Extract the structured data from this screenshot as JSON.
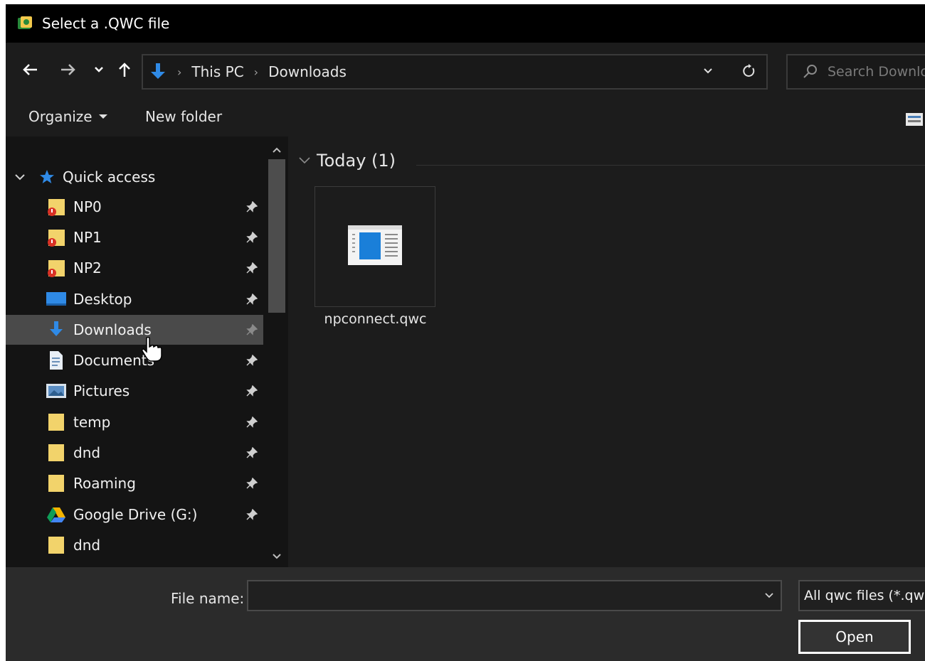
{
  "window": {
    "title": "Select a .QWC file"
  },
  "address_bar": {
    "segments": [
      "This PC",
      "Downloads"
    ]
  },
  "search": {
    "placeholder": "Search Downloads"
  },
  "toolbar": {
    "organize_label": "Organize",
    "new_folder_label": "New folder"
  },
  "nav_pane": {
    "quick_access_label": "Quick access",
    "items": [
      {
        "label": "NP0",
        "icon": "folder-warning-icon",
        "pinned": true
      },
      {
        "label": "NP1",
        "icon": "folder-warning-icon",
        "pinned": true
      },
      {
        "label": "NP2",
        "icon": "folder-warning-icon",
        "pinned": true
      },
      {
        "label": "Desktop",
        "icon": "desktop-icon",
        "pinned": true
      },
      {
        "label": "Downloads",
        "icon": "downloads-arrow-icon",
        "pinned": true,
        "selected": true
      },
      {
        "label": "Documents",
        "icon": "document-icon",
        "pinned": true
      },
      {
        "label": "Pictures",
        "icon": "pictures-icon",
        "pinned": true
      },
      {
        "label": "temp",
        "icon": "folder-icon",
        "pinned": true
      },
      {
        "label": "dnd",
        "icon": "folder-icon",
        "pinned": true
      },
      {
        "label": "Roaming",
        "icon": "folder-icon",
        "pinned": true
      },
      {
        "label": "Google Drive (G:)",
        "icon": "google-drive-icon",
        "pinned": true
      },
      {
        "label": "dnd",
        "icon": "folder-icon",
        "pinned": false
      }
    ]
  },
  "content": {
    "group_title": "Today (1)",
    "files": [
      {
        "name": "npconnect.qwc",
        "icon": "qwc-file-icon"
      }
    ]
  },
  "footer": {
    "file_name_label": "File name:",
    "file_name_value": "",
    "file_type": "All qwc files (*.qwc)",
    "open_label": "Open"
  },
  "colors": {
    "accent": "#1e7fd9",
    "folder": "#f2d36b",
    "window_bg": "#1c1c1c",
    "titlebar": "#000000"
  }
}
